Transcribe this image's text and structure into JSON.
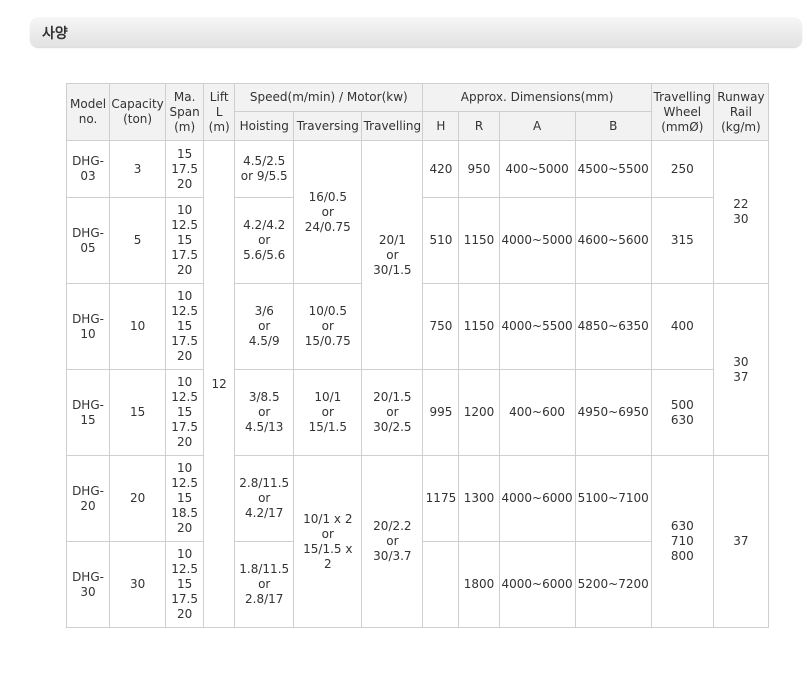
{
  "section": {
    "title": "사양"
  },
  "headers": {
    "model": "Model\nno.",
    "capacity": "Capacity\n(ton)",
    "span": "Ma.\nSpan\n(m)",
    "lift": "Lift\nL\n(m)",
    "speed_group": "Speed(m/min) / Motor(kw)",
    "hoisting": "Hoisting",
    "traversing": "Traversing",
    "travelling": "Travelling",
    "dims_group": "Approx. Dimensions(mm)",
    "H": "H",
    "R": "R",
    "A": "A",
    "B": "B",
    "wheel": "Travelling\nWheel\n(mmØ)",
    "rail": "Runway\nRail\n(kg/m)"
  },
  "rows": [
    {
      "model": "DHG-\n03",
      "capacity": "3",
      "span": "15\n17.5\n20",
      "hoisting": "4.5/2.5\nor 9/5.5",
      "H": "420",
      "R": "950",
      "A": "400~5000",
      "B": "4500~5500",
      "wheel": "250"
    },
    {
      "model": "DHG-\n05",
      "capacity": "5",
      "span": "10\n12.5\n15\n17.5\n20",
      "hoisting": "4.2/4.2\nor\n5.6/5.6",
      "H": "510",
      "R": "1150",
      "A": "4000~5000",
      "B": "4600~5600",
      "wheel": "315"
    },
    {
      "model": "DHG-\n10",
      "capacity": "10",
      "span": "10\n12.5\n15\n17.5\n20",
      "hoisting": "3/6\nor\n4.5/9",
      "traversing": "10/0.5\nor\n15/0.75",
      "H": "750",
      "R": "1150",
      "A": "4000~5500",
      "B": "4850~6350",
      "wheel": "400"
    },
    {
      "model": "DHG-\n15",
      "capacity": "15",
      "span": "10\n12.5\n15\n17.5\n20",
      "hoisting": "3/8.5\nor\n4.5/13",
      "traversing": "10/1\nor\n15/1.5",
      "travelling": "20/1.5\nor\n30/2.5",
      "H": "995",
      "R": "1200",
      "A": "400~600",
      "B": "4950~6950",
      "wheel": "500\n630"
    },
    {
      "model": "DHG-\n20",
      "capacity": "20",
      "span": "10\n12.5\n15\n18.5\n20",
      "hoisting": "2.8/11.5\nor\n4.2/17",
      "H": "1175",
      "R": "1300",
      "A": "4000~6000",
      "B": "5100~7100"
    },
    {
      "model": "DHG-\n30",
      "capacity": "30",
      "span": "10\n12.5\n15\n17.5\n20",
      "hoisting": "1.8/11.5\nor\n2.8/17",
      "H": "",
      "R": "1800",
      "A": "4000~6000",
      "B": "5200~7200"
    }
  ],
  "merged": {
    "lift": "12",
    "traversing_03_05": "16/0.5\nor\n24/0.75",
    "travelling_03_10": "20/1\nor\n30/1.5",
    "traversing_20_30": "10/1 x 2\nor\n15/1.5 x\n2",
    "travelling_20_30": "20/2.2\nor\n30/3.7",
    "wheel_20_30": "630\n710\n800",
    "rail_03_05": "22\n30",
    "rail_10_15": "30\n37",
    "rail_20_30": "37"
  }
}
